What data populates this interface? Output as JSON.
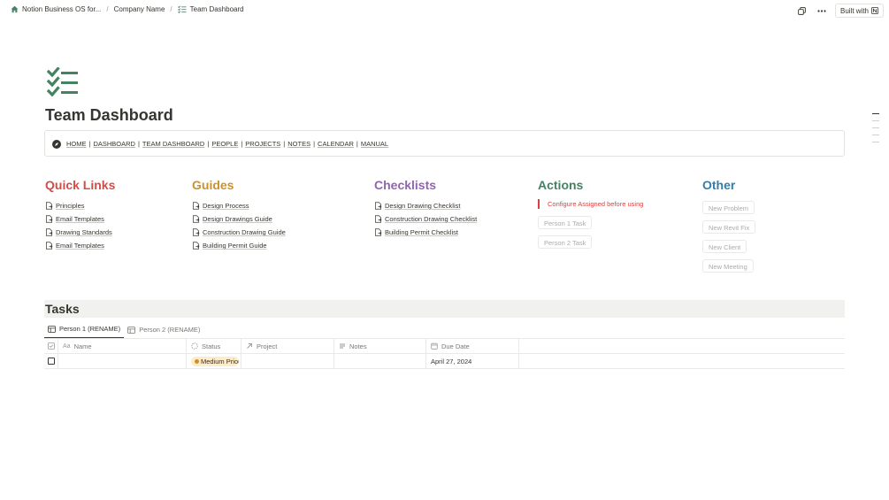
{
  "breadcrumb": {
    "items": [
      {
        "label": "Notion Business OS for...",
        "icon": "home-icon"
      },
      {
        "label": "Company Name",
        "icon": ""
      },
      {
        "label": "Team Dashboard",
        "icon": "checklist-icon"
      }
    ],
    "separator": "/"
  },
  "topbar": {
    "built_with_label": "Built with"
  },
  "page": {
    "title": "Team Dashboard",
    "icon": "checklist-icon",
    "icon_color": "#448361"
  },
  "nav": {
    "links": [
      "HOME",
      "DASHBOARD",
      "TEAM DASHBOARD",
      "PEOPLE",
      "PROJECTS",
      "NOTES",
      "CALENDAR",
      "MANUAL"
    ],
    "separator": "|"
  },
  "columns": {
    "quick_links": {
      "title": "Quick Links",
      "color": "#d44c47",
      "items": [
        "Principles",
        "Email Templates",
        "Drawing Standards",
        "Email Templates"
      ]
    },
    "guides": {
      "title": "Guides",
      "color": "#cb912f",
      "items": [
        "Design Process",
        "Design Drawings Guide",
        "Construction Drawing Guide",
        "Building Permit Guide"
      ]
    },
    "checklists": {
      "title": "Checklists",
      "color": "#9065b0",
      "items": [
        "Design Drawing Checklist",
        "Construction Drawing Checklist",
        "Building Permit Checklist"
      ]
    },
    "actions": {
      "title": "Actions",
      "color": "#448361",
      "note": "Configure Assigned before using",
      "note_color": "#e03e3e",
      "buttons": [
        "Person 1 Task",
        "Person 2 Task"
      ]
    },
    "other": {
      "title": "Other",
      "color": "#337ea9",
      "buttons": [
        "New Problem",
        "New Revit Fix",
        "New Client",
        "New Meeting"
      ]
    }
  },
  "tasks": {
    "title": "Tasks",
    "tabs": [
      "Person 1 (RENAME)",
      "Person 2 (RENAME)"
    ],
    "active_tab": 0,
    "columns": [
      "Name",
      "Status",
      "Project",
      "Notes",
      "Due Date"
    ],
    "rows": [
      {
        "name": "",
        "status": "Medium Priority",
        "project": "",
        "notes": "",
        "due_date": "April 27, 2024",
        "done": false
      }
    ]
  }
}
